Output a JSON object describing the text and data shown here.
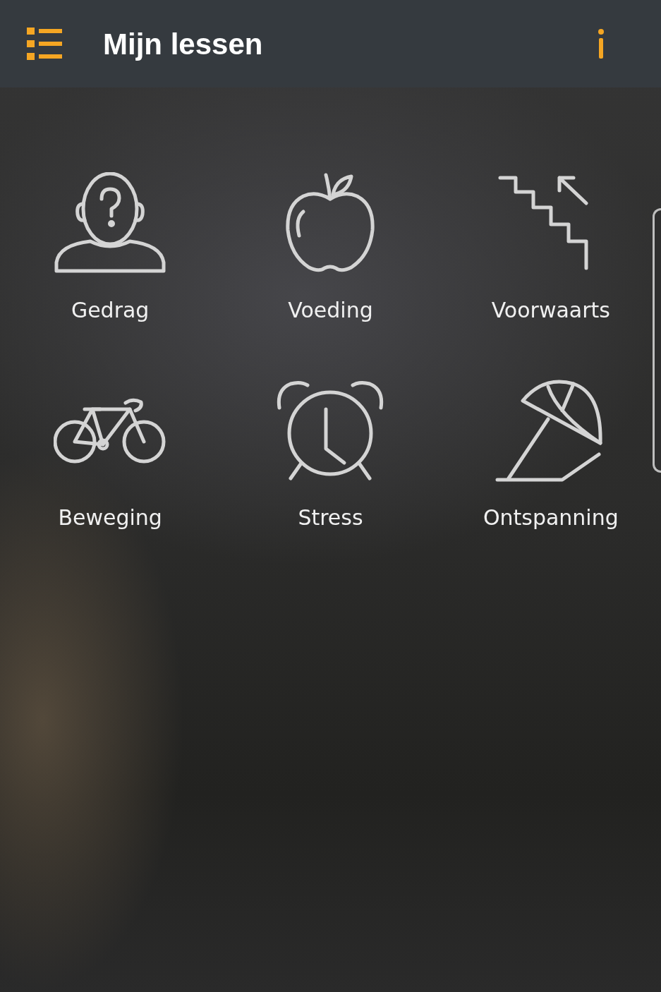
{
  "header": {
    "title": "Mijn lessen"
  },
  "lessons": [
    {
      "label": "Gedrag",
      "kind": "person"
    },
    {
      "label": "Voeding",
      "kind": "apple"
    },
    {
      "label": "Voorwaarts",
      "kind": "stairs"
    },
    {
      "label": "Beweging",
      "kind": "bicycle"
    },
    {
      "label": "Stress",
      "kind": "clock"
    },
    {
      "label": "Ontspanning",
      "kind": "umbrella"
    }
  ]
}
